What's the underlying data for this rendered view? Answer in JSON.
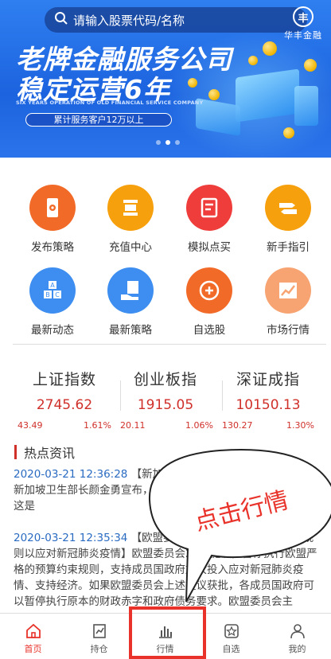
{
  "banner": {
    "search_placeholder": "请输入股票代码/名称",
    "brand_name": "华丰金融",
    "brand_logo_char": "丰",
    "headline_1": "老牌金融服务公司",
    "headline_2": "稳定运营6年",
    "subtitle_en": "SIX YEARS OPERATION OF OLD FINANCIAL SERVICE COMPANY",
    "tagline": "累计服务客户12万以上",
    "slides_count": 3,
    "active_slide": 1
  },
  "features": [
    {
      "label": "发布策略",
      "icon": "phone-gear-icon",
      "color": "#f26a28"
    },
    {
      "label": "充值中心",
      "icon": "card-stack-icon",
      "color": "#f7a00e"
    },
    {
      "label": "模拟点买",
      "icon": "document-icon",
      "color": "#ee3d3a"
    },
    {
      "label": "新手指引",
      "icon": "signpost-icon",
      "color": "#f7a00e"
    },
    {
      "label": "最新动态",
      "icon": "abc-blocks-icon",
      "color": "#3d8ef0"
    },
    {
      "label": "最新策略",
      "icon": "hand-document-icon",
      "color": "#3d8ef0"
    },
    {
      "label": "自选股",
      "icon": "plus-circle-icon",
      "color": "#f26a28"
    },
    {
      "label": "市场行情",
      "icon": "trend-chart-icon",
      "color": "#f7a472"
    }
  ],
  "indices": [
    {
      "name": "上证指数",
      "value": "2745.62",
      "change": "43.49",
      "percent": "1.61%"
    },
    {
      "name": "创业板指",
      "value": "1915.05",
      "change": "20.11",
      "percent": "1.06%"
    },
    {
      "name": "深证成指",
      "value": "10150.13",
      "change": "130.27",
      "percent": "1.30%"
    }
  ],
  "news": {
    "title": "热点资讯",
    "items": [
      {
        "date": "2020-03-21 12:36:28",
        "text": "【新加坡首次出现新冠肺炎患者死亡】新加坡卫生部长颜金勇宣布，新加坡出现2例新冠肺炎死亡病例，这是"
      },
      {
        "date": "2020-03-21 12:35:34",
        "text": "【欧盟委员会提议暂停执行欧盟财政规则以应对新冠肺炎疫情】欧盟委员会20日提议，暂停执行欧盟严格的预算约束规则，支持成员国政府加大投入应对新冠肺炎疫情、支持经济。如果欧盟委员会上述提议获批，各成员国政府可以暂停执行原本的财政赤字和政府债务要求。欧盟委员会主"
      }
    ]
  },
  "callout": {
    "text": "点击行情",
    "color": "#e8322a"
  },
  "tabbar": {
    "items": [
      {
        "label": "首页",
        "icon": "home-icon"
      },
      {
        "label": "持仓",
        "icon": "portfolio-icon"
      },
      {
        "label": "行情",
        "icon": "bar-chart-icon"
      },
      {
        "label": "自选",
        "icon": "star-box-icon"
      },
      {
        "label": "我的",
        "icon": "user-icon"
      }
    ],
    "active_index": 0,
    "highlighted_index": 2
  }
}
